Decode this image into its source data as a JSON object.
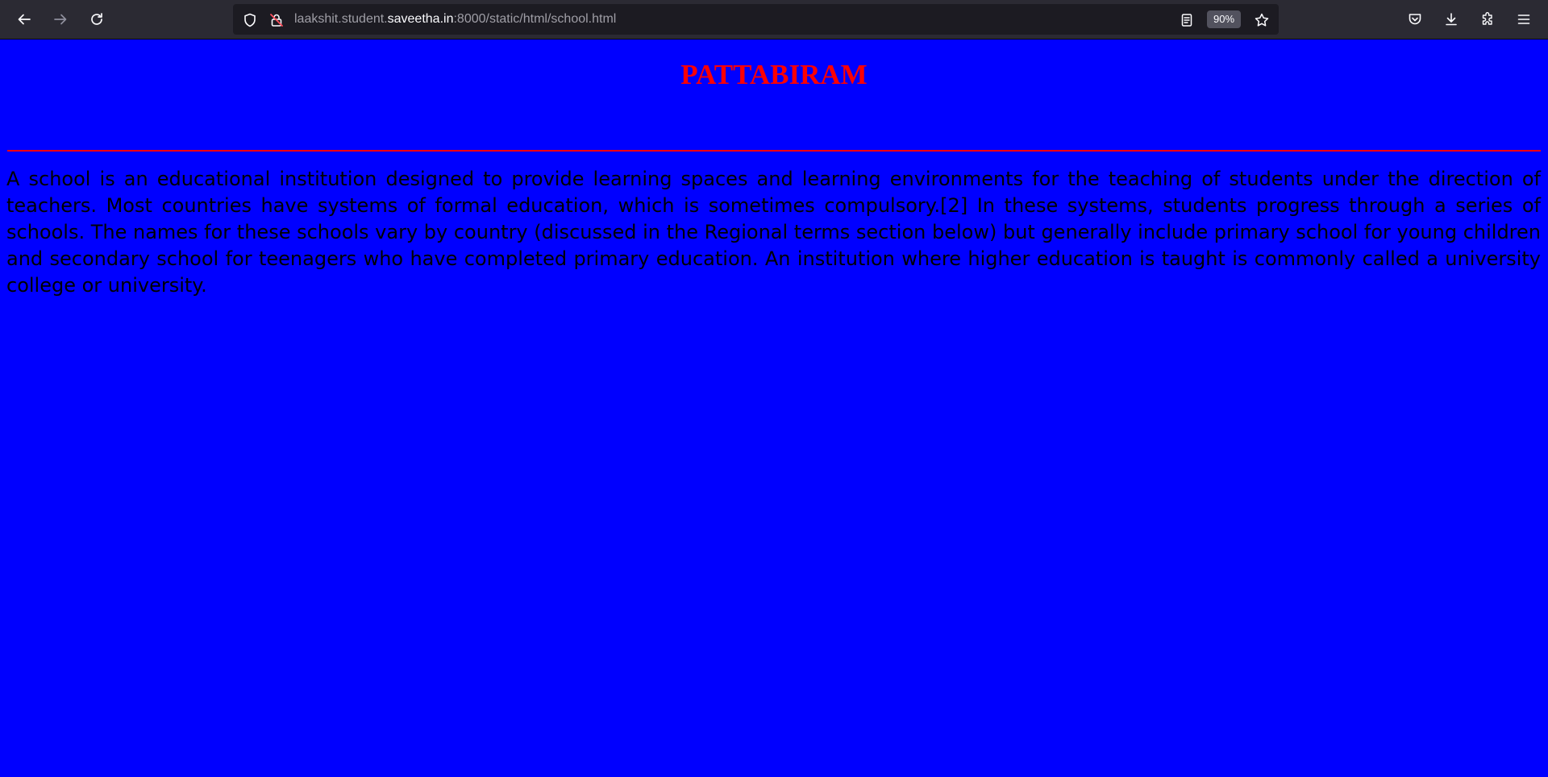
{
  "browser": {
    "url_prefix": "laakshit.student.",
    "url_host": "saveetha.in",
    "url_suffix": ":8000/static/html/school.html",
    "zoom": "90%",
    "icons": [
      "back-arrow-icon",
      "forward-arrow-icon",
      "reload-icon",
      "shield-icon",
      "insecure-lock-icon",
      "reader-view-icon",
      "bookmark-star-icon",
      "pocket-icon",
      "download-icon",
      "extensions-icon",
      "menu-icon"
    ]
  },
  "page": {
    "title": "PATTABIRAM",
    "paragraph": "A school is an educational institution designed to provide learning spaces and learning environments for the teaching of students under the direction of teachers. Most countries have systems of formal education, which is sometimes compulsory.[2] In these systems, students progress through a series of schools. The names for these schools vary by country (discussed in the Regional terms section below) but generally include primary school for young children and secondary school for teenagers who have completed primary education. An institution where higher education is taught is commonly called a university college or university.",
    "colors": {
      "background": "#0000ff",
      "title": "#ff0000",
      "divider": "#ff0000",
      "text": "#000000"
    }
  }
}
